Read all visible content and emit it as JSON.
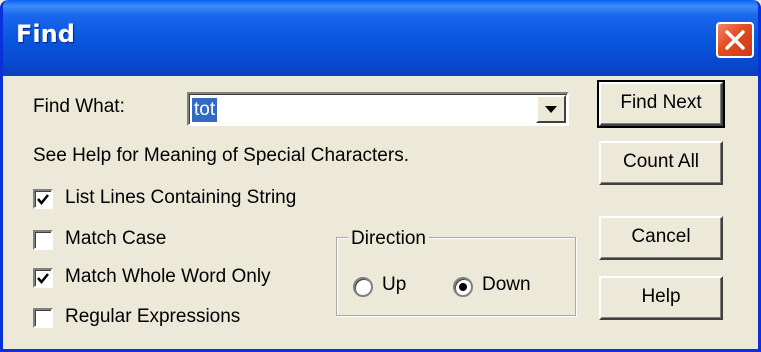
{
  "window": {
    "title": "Find"
  },
  "find_what": {
    "label": "Find What:",
    "value": "tot",
    "help_text": "See Help for Meaning of Special Characters."
  },
  "options": [
    {
      "label": "List Lines Containing String",
      "checked": true
    },
    {
      "label": "Match Case",
      "checked": false
    },
    {
      "label": "Match Whole Word Only",
      "checked": true
    },
    {
      "label": "Regular Expressions",
      "checked": false
    }
  ],
  "direction": {
    "legend": "Direction",
    "up_label": "Up",
    "down_label": "Down",
    "selected": "Down"
  },
  "buttons": {
    "find_next": "Find Next",
    "count_all": "Count All",
    "cancel": "Cancel",
    "help": "Help"
  },
  "icons": {
    "close": "close-icon",
    "dropdown": "chevron-down-icon",
    "check": "check-icon"
  },
  "colors": {
    "title_bar": "#0855dd",
    "close_button": "#e44a22",
    "selection": "#316ac5",
    "dialog_bg": "#ece9d8"
  }
}
